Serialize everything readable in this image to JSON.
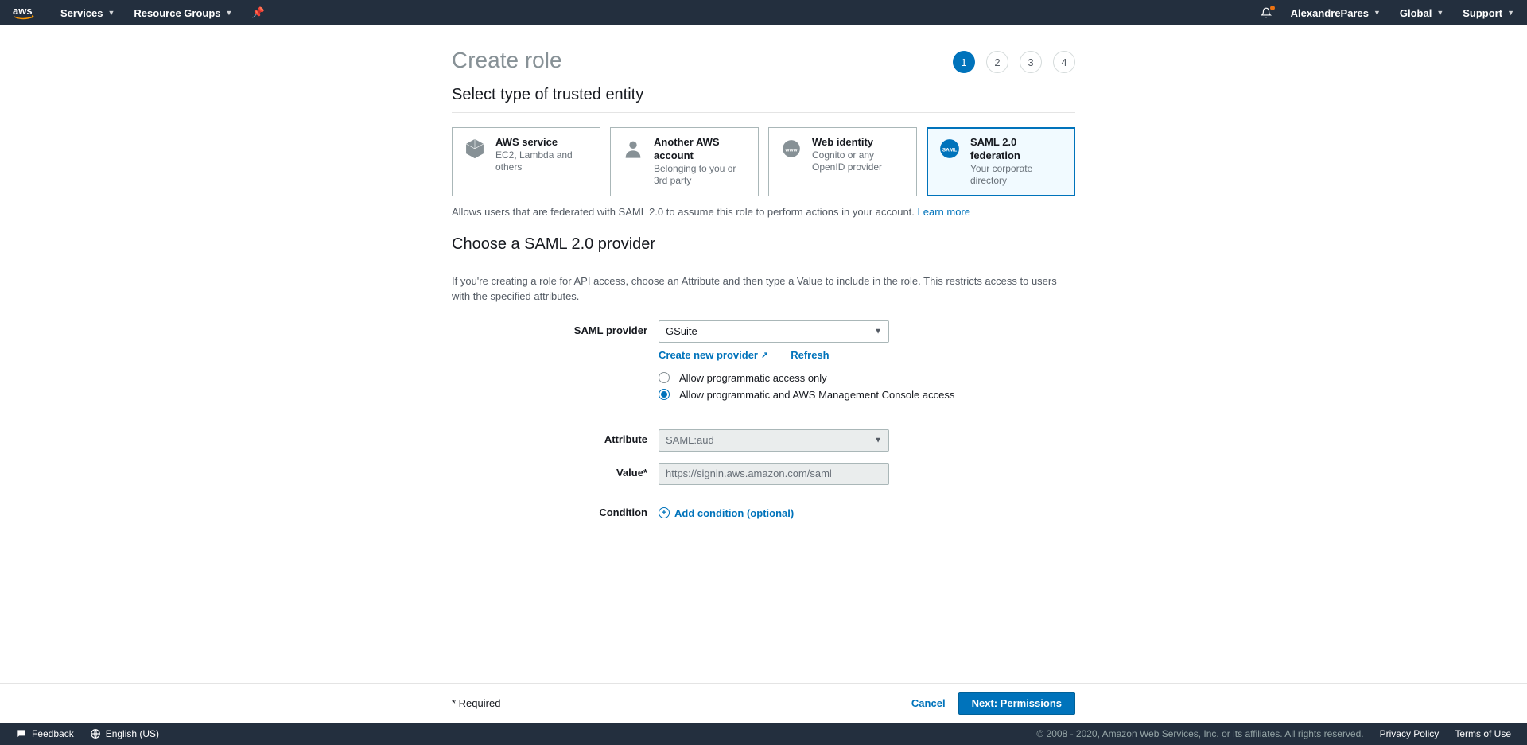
{
  "topnav": {
    "services": "Services",
    "resource_groups": "Resource Groups",
    "user": "AlexandrePares",
    "region": "Global",
    "support": "Support"
  },
  "page": {
    "title": "Create role",
    "steps": [
      "1",
      "2",
      "3",
      "4"
    ]
  },
  "section1": {
    "title": "Select type of trusted entity",
    "cards": [
      {
        "title": "AWS service",
        "subtitle": "EC2, Lambda and others"
      },
      {
        "title": "Another AWS account",
        "subtitle": "Belonging to you or 3rd party"
      },
      {
        "title": "Web identity",
        "subtitle": "Cognito or any OpenID provider"
      },
      {
        "title": "SAML 2.0 federation",
        "subtitle": "Your corporate directory"
      }
    ],
    "description": "Allows users that are federated with SAML 2.0 to assume this role to perform actions in your account. ",
    "learn_more": "Learn more"
  },
  "section2": {
    "title": "Choose a SAML 2.0 provider",
    "description": "If you're creating a role for API access, choose an Attribute and then type a Value to include in the role. This restricts access to users with the specified attributes.",
    "labels": {
      "saml_provider": "SAML provider",
      "attribute": "Attribute",
      "value": "Value*",
      "condition": "Condition"
    },
    "provider_value": "GSuite",
    "create_new_provider": "Create new provider",
    "refresh": "Refresh",
    "radio1": "Allow programmatic access only",
    "radio2": "Allow programmatic and AWS Management Console access",
    "attribute_value": "SAML:aud",
    "value_value": "https://signin.aws.amazon.com/saml",
    "add_condition": "Add condition (optional)"
  },
  "bottom": {
    "required": "* Required",
    "cancel": "Cancel",
    "next": "Next: Permissions"
  },
  "footer": {
    "feedback": "Feedback",
    "language": "English (US)",
    "copyright": "© 2008 - 2020, Amazon Web Services, Inc. or its affiliates. All rights reserved.",
    "privacy": "Privacy Policy",
    "terms": "Terms of Use"
  }
}
